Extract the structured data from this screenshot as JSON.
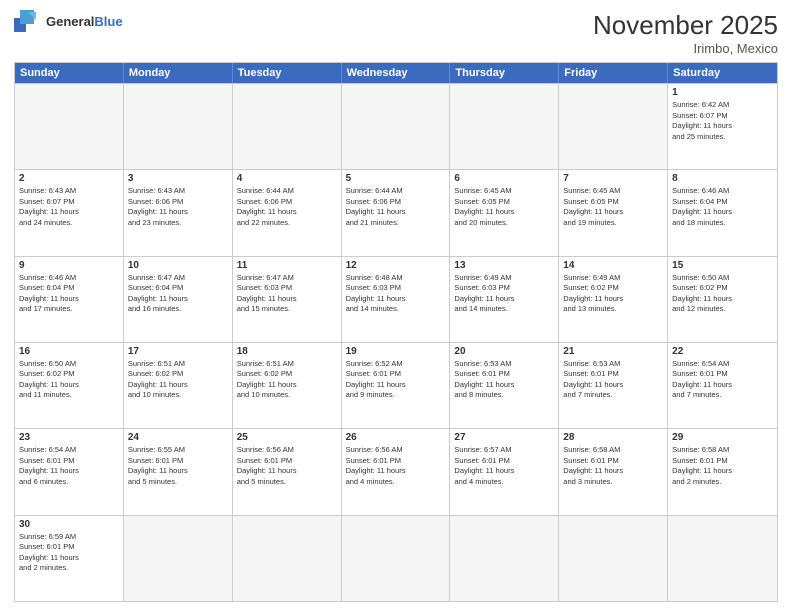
{
  "header": {
    "logo_general": "General",
    "logo_blue": "Blue",
    "month_title": "November 2025",
    "location": "Irimbo, Mexico"
  },
  "days_of_week": [
    "Sunday",
    "Monday",
    "Tuesday",
    "Wednesday",
    "Thursday",
    "Friday",
    "Saturday"
  ],
  "rows": [
    {
      "cells": [
        {
          "day": "",
          "text": "",
          "empty": true
        },
        {
          "day": "",
          "text": "",
          "empty": true
        },
        {
          "day": "",
          "text": "",
          "empty": true
        },
        {
          "day": "",
          "text": "",
          "empty": true
        },
        {
          "day": "",
          "text": "",
          "empty": true
        },
        {
          "day": "",
          "text": "",
          "empty": true
        },
        {
          "day": "1",
          "text": "Sunrise: 6:42 AM\nSunset: 6:07 PM\nDaylight: 11 hours\nand 25 minutes."
        }
      ]
    },
    {
      "cells": [
        {
          "day": "2",
          "text": "Sunrise: 6:43 AM\nSunset: 6:07 PM\nDaylight: 11 hours\nand 24 minutes."
        },
        {
          "day": "3",
          "text": "Sunrise: 6:43 AM\nSunset: 6:06 PM\nDaylight: 11 hours\nand 23 minutes."
        },
        {
          "day": "4",
          "text": "Sunrise: 6:44 AM\nSunset: 6:06 PM\nDaylight: 11 hours\nand 22 minutes."
        },
        {
          "day": "5",
          "text": "Sunrise: 6:44 AM\nSunset: 6:06 PM\nDaylight: 11 hours\nand 21 minutes."
        },
        {
          "day": "6",
          "text": "Sunrise: 6:45 AM\nSunset: 6:05 PM\nDaylight: 11 hours\nand 20 minutes."
        },
        {
          "day": "7",
          "text": "Sunrise: 6:45 AM\nSunset: 6:05 PM\nDaylight: 11 hours\nand 19 minutes."
        },
        {
          "day": "8",
          "text": "Sunrise: 6:46 AM\nSunset: 6:04 PM\nDaylight: 11 hours\nand 18 minutes."
        }
      ]
    },
    {
      "cells": [
        {
          "day": "9",
          "text": "Sunrise: 6:46 AM\nSunset: 6:04 PM\nDaylight: 11 hours\nand 17 minutes."
        },
        {
          "day": "10",
          "text": "Sunrise: 6:47 AM\nSunset: 6:04 PM\nDaylight: 11 hours\nand 16 minutes."
        },
        {
          "day": "11",
          "text": "Sunrise: 6:47 AM\nSunset: 6:03 PM\nDaylight: 11 hours\nand 15 minutes."
        },
        {
          "day": "12",
          "text": "Sunrise: 6:48 AM\nSunset: 6:03 PM\nDaylight: 11 hours\nand 14 minutes."
        },
        {
          "day": "13",
          "text": "Sunrise: 6:49 AM\nSunset: 6:03 PM\nDaylight: 11 hours\nand 14 minutes."
        },
        {
          "day": "14",
          "text": "Sunrise: 6:49 AM\nSunset: 6:02 PM\nDaylight: 11 hours\nand 13 minutes."
        },
        {
          "day": "15",
          "text": "Sunrise: 6:50 AM\nSunset: 6:02 PM\nDaylight: 11 hours\nand 12 minutes."
        }
      ]
    },
    {
      "cells": [
        {
          "day": "16",
          "text": "Sunrise: 6:50 AM\nSunset: 6:02 PM\nDaylight: 11 hours\nand 11 minutes."
        },
        {
          "day": "17",
          "text": "Sunrise: 6:51 AM\nSunset: 6:02 PM\nDaylight: 11 hours\nand 10 minutes."
        },
        {
          "day": "18",
          "text": "Sunrise: 6:51 AM\nSunset: 6:02 PM\nDaylight: 11 hours\nand 10 minutes."
        },
        {
          "day": "19",
          "text": "Sunrise: 6:52 AM\nSunset: 6:01 PM\nDaylight: 11 hours\nand 9 minutes."
        },
        {
          "day": "20",
          "text": "Sunrise: 6:53 AM\nSunset: 6:01 PM\nDaylight: 11 hours\nand 8 minutes."
        },
        {
          "day": "21",
          "text": "Sunrise: 6:53 AM\nSunset: 6:01 PM\nDaylight: 11 hours\nand 7 minutes."
        },
        {
          "day": "22",
          "text": "Sunrise: 6:54 AM\nSunset: 6:01 PM\nDaylight: 11 hours\nand 7 minutes."
        }
      ]
    },
    {
      "cells": [
        {
          "day": "23",
          "text": "Sunrise: 6:54 AM\nSunset: 6:01 PM\nDaylight: 11 hours\nand 6 minutes."
        },
        {
          "day": "24",
          "text": "Sunrise: 6:55 AM\nSunset: 6:01 PM\nDaylight: 11 hours\nand 5 minutes."
        },
        {
          "day": "25",
          "text": "Sunrise: 6:56 AM\nSunset: 6:01 PM\nDaylight: 11 hours\nand 5 minutes."
        },
        {
          "day": "26",
          "text": "Sunrise: 6:56 AM\nSunset: 6:01 PM\nDaylight: 11 hours\nand 4 minutes."
        },
        {
          "day": "27",
          "text": "Sunrise: 6:57 AM\nSunset: 6:01 PM\nDaylight: 11 hours\nand 4 minutes."
        },
        {
          "day": "28",
          "text": "Sunrise: 6:58 AM\nSunset: 6:01 PM\nDaylight: 11 hours\nand 3 minutes."
        },
        {
          "day": "29",
          "text": "Sunrise: 6:58 AM\nSunset: 6:01 PM\nDaylight: 11 hours\nand 2 minutes."
        }
      ]
    },
    {
      "cells": [
        {
          "day": "30",
          "text": "Sunrise: 6:59 AM\nSunset: 6:01 PM\nDaylight: 11 hours\nand 2 minutes."
        },
        {
          "day": "",
          "text": "",
          "empty": true
        },
        {
          "day": "",
          "text": "",
          "empty": true
        },
        {
          "day": "",
          "text": "",
          "empty": true
        },
        {
          "day": "",
          "text": "",
          "empty": true
        },
        {
          "day": "",
          "text": "",
          "empty": true
        },
        {
          "day": "",
          "text": "",
          "empty": true
        }
      ]
    }
  ]
}
